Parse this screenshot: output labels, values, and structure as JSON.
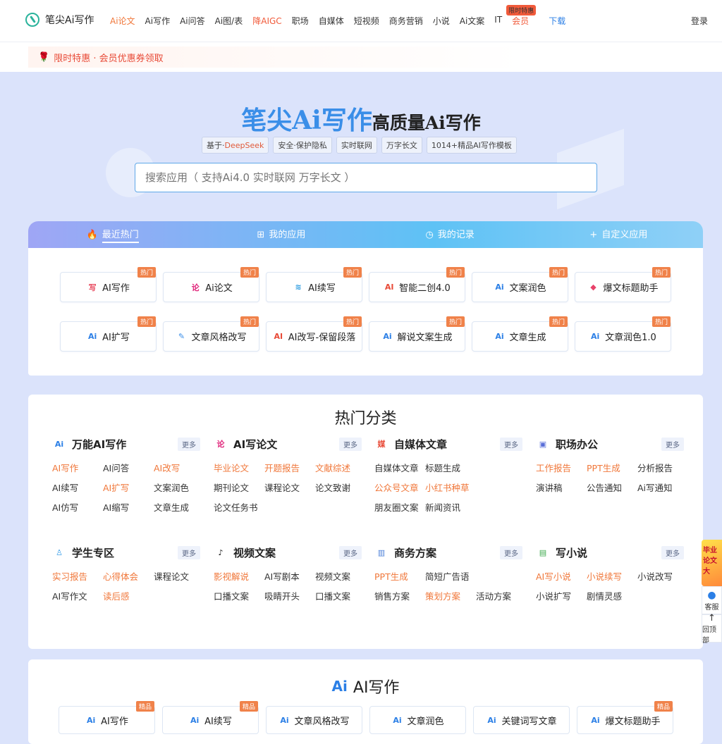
{
  "header": {
    "logo_text": "笔尖Ai写作",
    "nav": [
      {
        "label": "Ai论文",
        "style": "active"
      },
      {
        "label": "Ai写作",
        "style": ""
      },
      {
        "label": "Ai问答",
        "style": ""
      },
      {
        "label": "Ai图/表",
        "style": ""
      },
      {
        "label": "降AIGC",
        "style": "red"
      },
      {
        "label": "职场",
        "style": ""
      },
      {
        "label": "自媒体",
        "style": ""
      },
      {
        "label": "短视频",
        "style": ""
      },
      {
        "label": "商务营销",
        "style": ""
      },
      {
        "label": "小说",
        "style": ""
      },
      {
        "label": "Ai文案",
        "style": ""
      },
      {
        "label": "IT",
        "style": ""
      },
      {
        "label": "会员",
        "style": "red"
      },
      {
        "label": "下载",
        "style": "blue"
      }
    ],
    "vip_badge": "限时特惠",
    "login": "登录"
  },
  "promo": {
    "text": "限时特惠 · 会员优惠券领取"
  },
  "hero": {
    "title": "笔尖Ai写作",
    "subtitle": "高质量Ai写作",
    "tags": [
      "基于·",
      "DeepSeek",
      "安全·保护隐私",
      "实时联网",
      "万字长文",
      "1014+精品AI写作模板"
    ],
    "search_placeholder": "搜索应用（ 支持Ai4.0 实时联网 万字长文 ）"
  },
  "tabs": [
    {
      "label": "最近热门",
      "icon": "fire-icon"
    },
    {
      "label": "我的应用",
      "icon": "grid-icon"
    },
    {
      "label": "我的记录",
      "icon": "clock-icon"
    },
    {
      "label": "自定义应用",
      "icon": "plus-icon"
    }
  ],
  "hot_badge": "热门",
  "recent_apps": [
    {
      "label": "AI写作",
      "icon": "写",
      "color": "#e84a5f"
    },
    {
      "label": "Ai论文",
      "icon": "论",
      "color": "#e0247a"
    },
    {
      "label": "AI续写",
      "icon": "≋",
      "color": "#2b9be0"
    },
    {
      "label": "智能二创4.0",
      "icon": "AI",
      "color": "#e84a37"
    },
    {
      "label": "文案润色",
      "icon": "Ai",
      "color": "#2b7fe6"
    },
    {
      "label": "爆文标题助手",
      "icon": "◆",
      "color": "#e8426a"
    },
    {
      "label": "AI扩写",
      "icon": "Ai",
      "color": "#2b7fe6"
    },
    {
      "label": "文章风格改写",
      "icon": "✎",
      "color": "#3a8ee8"
    },
    {
      "label": "AI改写-保留段落",
      "icon": "AI",
      "color": "#e84a37"
    },
    {
      "label": "解说文案生成",
      "icon": "Ai",
      "color": "#2b7fe6"
    },
    {
      "label": "文章生成",
      "icon": "Ai",
      "color": "#2b7fe6"
    },
    {
      "label": "文章润色1.0",
      "icon": "Ai",
      "color": "#2b7fe6"
    }
  ],
  "categories_title": "热门分类",
  "more_label": "更多",
  "categories": [
    {
      "title": "万能AI写作",
      "icon": "Ai",
      "color": "#2b7fe6",
      "links": [
        {
          "t": "AI写作",
          "o": true
        },
        {
          "t": "AI问答",
          "o": false
        },
        {
          "t": "AI改写",
          "o": true
        },
        {
          "t": "AI续写",
          "o": false
        },
        {
          "t": "AI扩写",
          "o": true
        },
        {
          "t": "文案润色",
          "o": false
        },
        {
          "t": "AI仿写",
          "o": false
        },
        {
          "t": "AI缩写",
          "o": false
        },
        {
          "t": "文章生成",
          "o": false
        }
      ]
    },
    {
      "title": "AI写论文",
      "icon": "论",
      "color": "#e0247a",
      "links": [
        {
          "t": "毕业论文",
          "o": true
        },
        {
          "t": "开题报告",
          "o": true
        },
        {
          "t": "文献综述",
          "o": true
        },
        {
          "t": "期刊论文",
          "o": false
        },
        {
          "t": "课程论文",
          "o": false
        },
        {
          "t": "论文致谢",
          "o": false
        },
        {
          "t": "论文任务书",
          "o": false
        }
      ]
    },
    {
      "title": "自媒体文章",
      "icon": "媒",
      "color": "#e84a37",
      "links": [
        {
          "t": "自媒体文章",
          "o": false
        },
        {
          "t": "标题生成",
          "o": false
        },
        {
          "t": "",
          "o": false
        },
        {
          "t": "公众号文章",
          "o": true
        },
        {
          "t": "小红书种草",
          "o": true
        },
        {
          "t": "",
          "o": false
        },
        {
          "t": "朋友圈文案",
          "o": false
        },
        {
          "t": "新闻资讯",
          "o": false
        }
      ]
    },
    {
      "title": "职场办公",
      "icon": "▣",
      "color": "#5a6fd8",
      "links": [
        {
          "t": "工作报告",
          "o": true
        },
        {
          "t": "PPT生成",
          "o": true
        },
        {
          "t": "分析报告",
          "o": false
        },
        {
          "t": "演讲稿",
          "o": false
        },
        {
          "t": "公告通知",
          "o": false
        },
        {
          "t": "Ai写通知",
          "o": false
        }
      ]
    },
    {
      "title": "学生专区",
      "icon": "♙",
      "color": "#3a9ee8",
      "links": [
        {
          "t": "实习报告",
          "o": true
        },
        {
          "t": "心得体会",
          "o": true
        },
        {
          "t": "课程论文",
          "o": false
        },
        {
          "t": "AI写作文",
          "o": false
        },
        {
          "t": "读后感",
          "o": true
        }
      ]
    },
    {
      "title": "视频文案",
      "icon": "♪",
      "color": "#111111",
      "links": [
        {
          "t": "影视解说",
          "o": true
        },
        {
          "t": "AI写剧本",
          "o": false
        },
        {
          "t": "视频文案",
          "o": false
        },
        {
          "t": "口播文案",
          "o": false
        },
        {
          "t": "吸睛开头",
          "o": false
        },
        {
          "t": "口播文案",
          "o": false
        }
      ]
    },
    {
      "title": "商务方案",
      "icon": "▥",
      "color": "#4a7fd8",
      "links": [
        {
          "t": "PPT生成",
          "o": true
        },
        {
          "t": "简短广告语",
          "o": false
        },
        {
          "t": "",
          "o": false
        },
        {
          "t": "销售方案",
          "o": false
        },
        {
          "t": "策划方案",
          "o": true
        },
        {
          "t": "活动方案",
          "o": false
        }
      ]
    },
    {
      "title": "写小说",
      "icon": "▤",
      "color": "#3aa84a",
      "links": [
        {
          "t": "AI写小说",
          "o": true
        },
        {
          "t": "小说续写",
          "o": true
        },
        {
          "t": "小说改写",
          "o": false
        },
        {
          "t": "小说扩写",
          "o": false
        },
        {
          "t": "剧情灵感",
          "o": false
        }
      ]
    }
  ],
  "section3": {
    "title": "AI写作",
    "badge": "精品",
    "apps": [
      {
        "label": "AI写作",
        "badge": true
      },
      {
        "label": "AI续写",
        "badge": true
      },
      {
        "label": "文章风格改写",
        "badge": false
      },
      {
        "label": "文章润色",
        "badge": false
      },
      {
        "label": "关键词写文章",
        "badge": false
      },
      {
        "label": "爆文标题助手",
        "badge": true
      }
    ]
  },
  "float": {
    "ad": "毕业论文 大",
    "service": "客服",
    "top": "回顶部"
  }
}
